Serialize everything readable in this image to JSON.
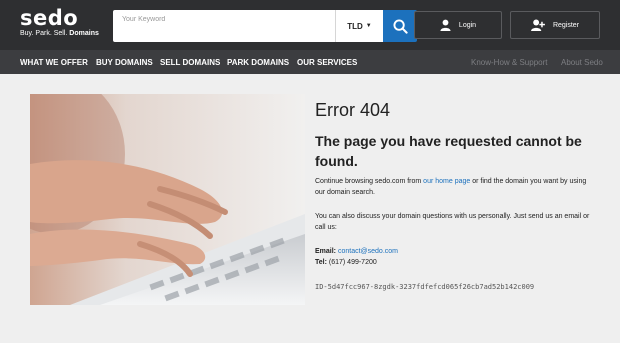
{
  "header": {
    "logo": {
      "name": "sedo",
      "tagline_plain": "Buy. Park. Sell.",
      "tagline_bold": "Domains"
    },
    "search": {
      "placeholder": "Your Keyword",
      "tld_label": "TLD",
      "search_icon": "magnifier-icon"
    },
    "login_label": "Login",
    "register_label": "Register"
  },
  "nav": {
    "items": [
      "WHAT WE OFFER",
      "BUY DOMAINS",
      "SELL DOMAINS",
      "PARK DOMAINS",
      "OUR SERVICES"
    ],
    "right_items": [
      "Know-How & Support",
      "About Sedo"
    ]
  },
  "error": {
    "title": "Error 404",
    "subtitle": "The page you have requested cannot be found.",
    "p1_before": "Continue browsing sedo.com from ",
    "p1_link": "our home page",
    "p1_after": " or find the domain you want by using our domain search.",
    "p2": "You can also discuss your domain questions with us personally. Just send us an email or call us:",
    "email_label": "Email:",
    "email_value": "contact@sedo.com",
    "tel_label": "Tel:",
    "tel_value": "(617) 499-7200",
    "error_id": "ID-5d47fcc967-8zgdk-3237fdfefcd065f26cb7ad52b142c009"
  },
  "colors": {
    "header_bg": "#2e2f31",
    "nav_bg": "#3c3d40",
    "accent": "#1c71bd",
    "page_bg": "#efefef"
  }
}
